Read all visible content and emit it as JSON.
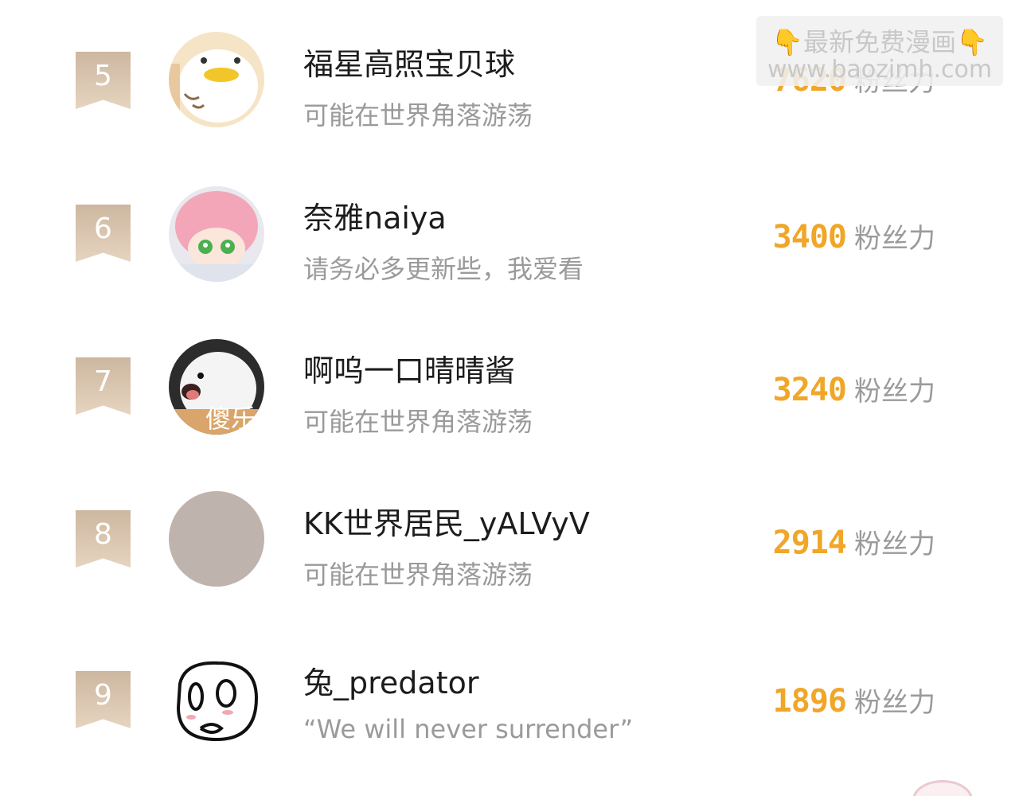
{
  "watermark": {
    "line1": "最新免费漫画",
    "hand_left": "👇",
    "hand_right": "👇",
    "line2": "www.baozimh.com"
  },
  "score_unit": "粉丝力",
  "rows": [
    {
      "rank": "5",
      "name": "福星高照宝贝球",
      "desc": "可能在世界角落游荡",
      "score": "7620",
      "avatar_icon": "duck-avatar"
    },
    {
      "rank": "6",
      "name": "奈雅naiya",
      "desc": "请务必多更新些，我爱看",
      "score": "3400",
      "avatar_icon": "pink-hair-plush-avatar"
    },
    {
      "rank": "7",
      "name": "啊呜一口晴晴酱",
      "desc": "可能在世界角落游荡",
      "score": "3240",
      "avatar_icon": "white-dog-avatar",
      "avatar_text": "傻乐"
    },
    {
      "rank": "8",
      "name": "KK世界居民_yALVyV",
      "desc": "可能在世界角落游荡",
      "score": "2914",
      "avatar_icon": "gray-avatar"
    },
    {
      "rank": "9",
      "name": "兔_predator",
      "desc": "“We will never surrender”",
      "score": "1896",
      "avatar_icon": "doodle-face-avatar"
    }
  ],
  "colors": {
    "score": "#f0a628",
    "rank_badge": "#d6c0a8",
    "name": "#1c1c1c",
    "desc": "#9a9a9a"
  }
}
